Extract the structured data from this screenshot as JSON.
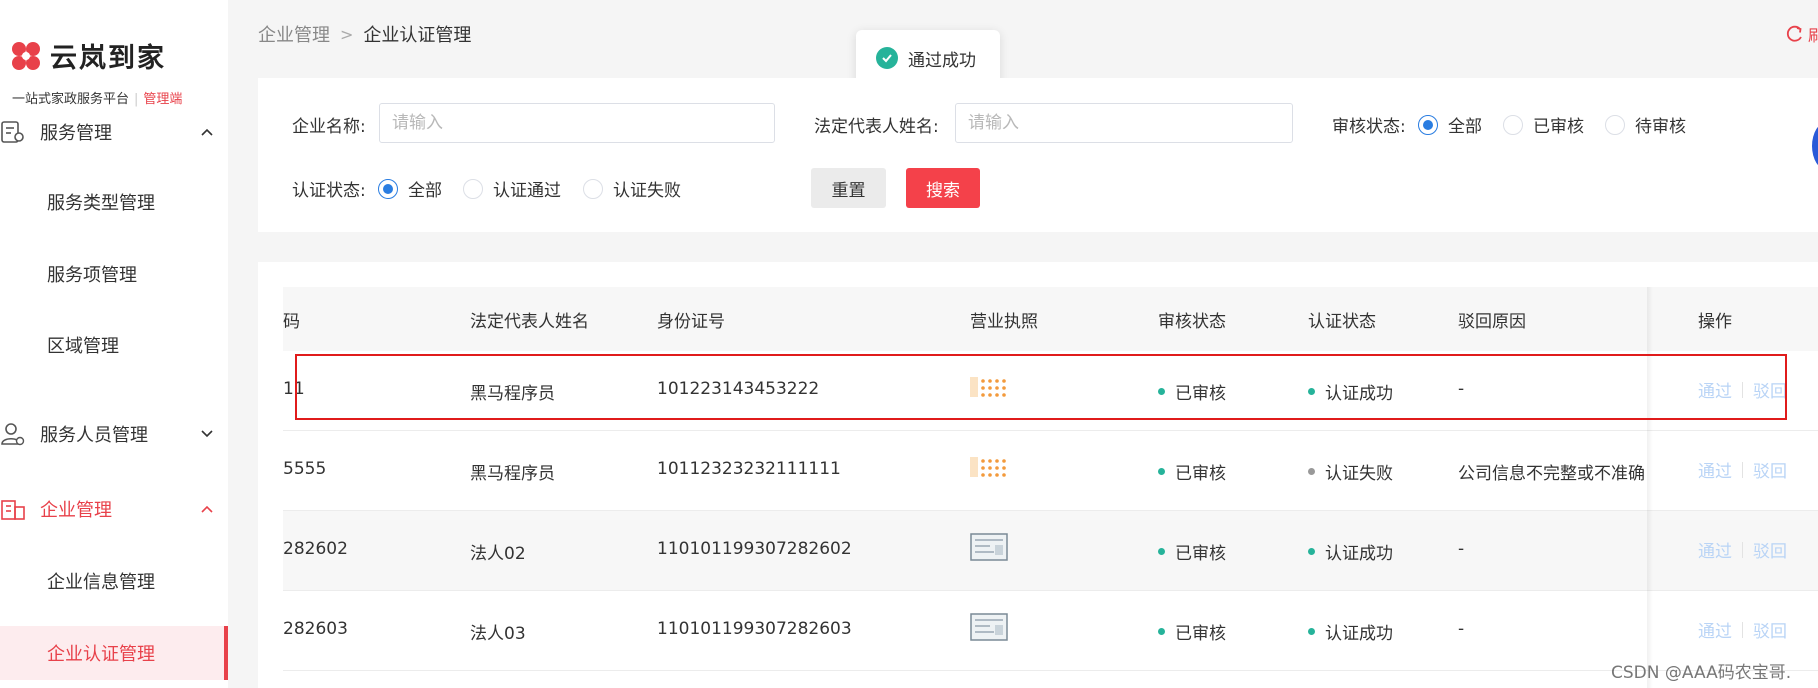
{
  "sidebar": {
    "logo_text": "云岚到家",
    "slogan": "一站式家政服务平台",
    "slogan_admin": "管理端",
    "groups": [
      {
        "label": "服务管理",
        "items": [
          "服务类型管理",
          "服务项管理",
          "区域管理"
        ]
      },
      {
        "label": "服务人员管理"
      },
      {
        "label": "企业管理",
        "items": [
          "企业信息管理",
          "企业认证管理"
        ]
      }
    ]
  },
  "breadcrumb": {
    "parent": "企业管理",
    "current": "企业认证管理"
  },
  "refresh_label": "刷",
  "toast": {
    "text": "通过成功"
  },
  "filters": {
    "company_name_label": "企业名称:",
    "company_name_placeholder": "请输入",
    "legal_rep_label": "法定代表人姓名:",
    "legal_rep_placeholder": "请输入",
    "audit_status_label": "审核状态:",
    "audit_options": [
      "全部",
      "已审核",
      "待审核"
    ],
    "cert_status_label": "认证状态:",
    "cert_options": [
      "全部",
      "认证通过",
      "认证失败"
    ],
    "reset_label": "重置",
    "search_label": "搜索"
  },
  "table": {
    "columns": [
      "码",
      "法定代表人姓名",
      "身份证号",
      "营业执照",
      "审核状态",
      "认证状态",
      "驳回原因",
      "操作"
    ],
    "rows": [
      {
        "code": "11",
        "legal_rep": "黑马程序员",
        "id_no": "101223143453222",
        "license": "doc",
        "audit": "已审核",
        "cert": "认证成功",
        "reason": "-",
        "op_pass": "通过",
        "op_reject": "驳回"
      },
      {
        "code": "5555",
        "legal_rep": "黑马程序员",
        "id_no": "10112323232111111",
        "license": "doc",
        "audit": "已审核",
        "cert": "认证失败",
        "reason": "公司信息不完整或不准确",
        "op_pass": "通过",
        "op_reject": "驳回"
      },
      {
        "code": "282602",
        "legal_rep": "法人02",
        "id_no": "110101199307282602",
        "license": "card",
        "audit": "已审核",
        "cert": "认证成功",
        "reason": "-",
        "op_pass": "通过",
        "op_reject": "驳回"
      },
      {
        "code": "282603",
        "legal_rep": "法人03",
        "id_no": "110101199307282603",
        "license": "card",
        "audit": "已审核",
        "cert": "认证成功",
        "reason": "-",
        "op_pass": "通过",
        "op_reject": "驳回"
      }
    ]
  },
  "watermark": "CSDN @AAA码农宝哥.",
  "colors": {
    "brand": "#e8414a",
    "success": "#26b39a",
    "primary": "#2a7de1",
    "link_disabled": "#b9d4f6"
  }
}
